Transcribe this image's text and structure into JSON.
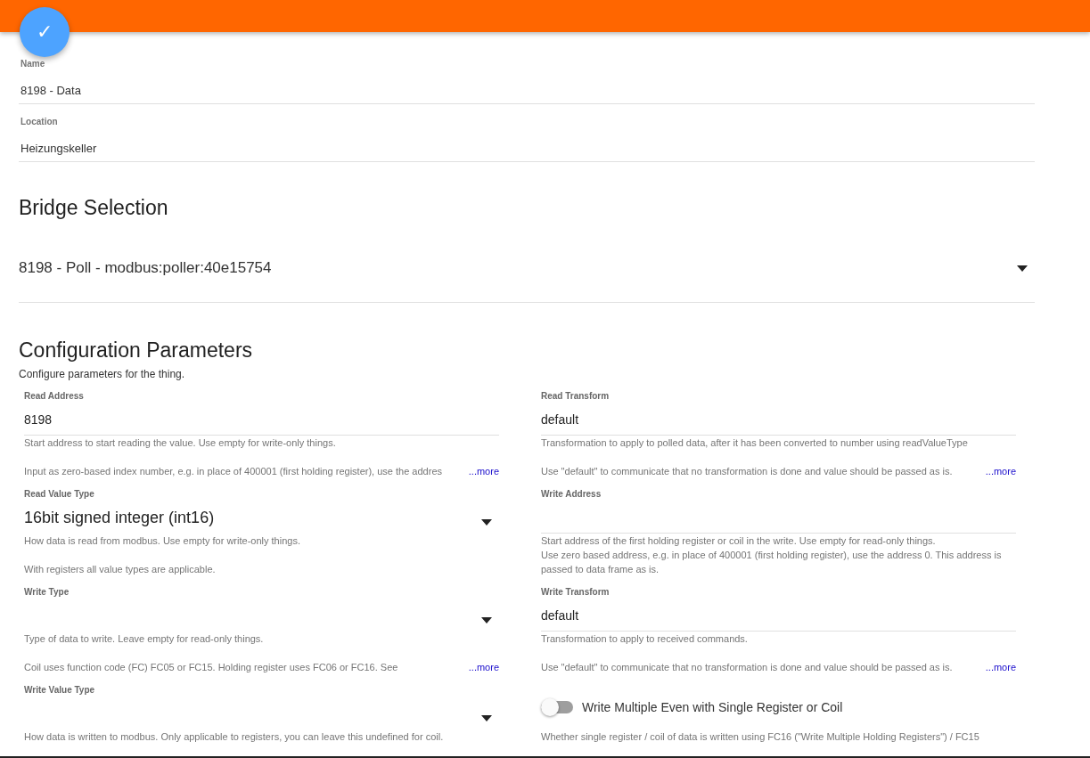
{
  "header": {
    "save_button": "✓"
  },
  "general": [
    {
      "label": "Name",
      "value": "8198 - Data"
    },
    {
      "label": "Location",
      "value": "Heizungskeller"
    }
  ],
  "bridge": {
    "heading": "Bridge Selection",
    "value": "8198 - Poll - modbus:poller:40e15754"
  },
  "config": {
    "heading": "Configuration Parameters",
    "subtitle": "Configure parameters for the thing.",
    "fields": [
      {
        "kind": "text",
        "label": "Read Address",
        "value": "8198",
        "description": [
          "Start address to start reading the value. Use empty for write-only things."
        ],
        "detail": "Input as zero-based index number, e.g. in place of 400001 (first holding register), use the addres",
        "more": "...more"
      },
      {
        "kind": "text",
        "label": "Read Transform",
        "value": "default",
        "description": [
          "Transformation to apply to polled data, after it has been converted to number using readValueType"
        ],
        "detail": "Use \"default\" to communicate that no transformation is done and value should be passed as is.",
        "more": "...more"
      },
      {
        "kind": "select",
        "label": "Read Value Type",
        "value": "16bit signed integer (int16)",
        "description": [
          "How data is read from modbus. Use empty for write-only things."
        ],
        "detail": "With registers all value types are applicable."
      },
      {
        "kind": "text",
        "label": "Write Address",
        "description": [
          "Start address of the first holding register or coil in the write. Use empty for read-only things.",
          "Use zero based address, e.g. in place of 400001 (first holding register), use the address 0. This address is passed to data frame as is."
        ]
      },
      {
        "kind": "select",
        "label": "Write Type",
        "description": [
          "Type of data to write. Leave empty for read-only things."
        ],
        "detail": "Coil uses function code (FC) FC05 or FC15. Holding register uses FC06 or FC16. See",
        "more": "...more"
      },
      {
        "kind": "text",
        "label": "Write Transform",
        "value": "default",
        "description": [
          "Transformation to apply to received commands."
        ],
        "detail": "Use \"default\" to communicate that no transformation is done and value should be passed as is.",
        "more": "...more"
      },
      {
        "kind": "select",
        "label": "Write Value Type",
        "description": [
          "How data is written to modbus. Only applicable to registers, you can leave this undefined for coil."
        ]
      },
      {
        "kind": "toggle",
        "label": "Write Multiple Even with Single Register or Coil",
        "on": false,
        "description": [
          "Whether single register / coil of data is written using FC16 (\"Write Multiple Holding Registers\") / FC15"
        ]
      }
    ]
  }
}
